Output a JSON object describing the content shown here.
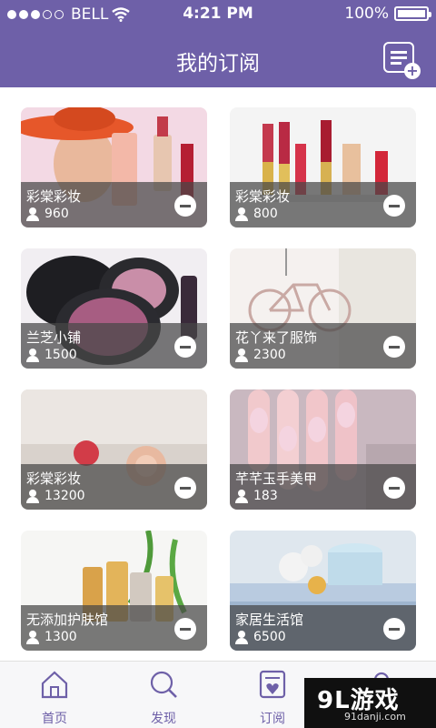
{
  "status_bar": {
    "carrier": "BELL",
    "time": "4:21 PM",
    "battery": "100%",
    "signal_icon": "signal-dots-icon",
    "wifi_icon": "wifi-icon",
    "battery_icon": "battery-icon"
  },
  "header": {
    "title": "我的订阅",
    "action_icon": "add-subscription-icon",
    "background": "#6e60a8"
  },
  "subscriptions": [
    {
      "name": "彩棠彩妆",
      "count": "960"
    },
    {
      "name": "彩棠彩妆",
      "count": "800"
    },
    {
      "name": "兰芝小铺",
      "count": "1500"
    },
    {
      "name": "花丫来了服饰",
      "count": "2300"
    },
    {
      "name": "彩棠彩妆",
      "count": "13200"
    },
    {
      "name": "芊芊玉手美甲",
      "count": "183"
    },
    {
      "name": "无添加护肤馆",
      "count": "1300"
    },
    {
      "name": "家居生活馆",
      "count": "6500"
    }
  ],
  "tabbar": {
    "items": [
      {
        "label": "首页",
        "icon": "home-icon"
      },
      {
        "label": "发现",
        "icon": "search-icon"
      },
      {
        "label": "订阅",
        "icon": "subscription-icon"
      },
      {
        "label": "",
        "icon": "profile-icon"
      }
    ],
    "active": "订阅"
  },
  "watermark": {
    "brand": "9L游戏",
    "url": "91danji.com"
  }
}
